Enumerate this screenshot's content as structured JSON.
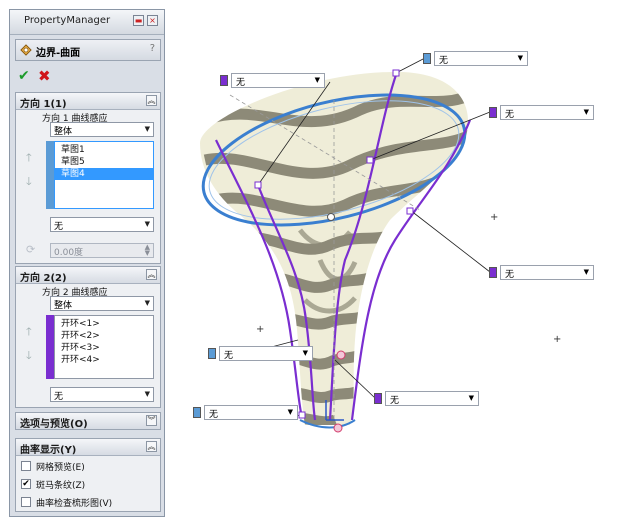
{
  "property_manager": {
    "title": "PropertyManager",
    "feature_title": "边界-曲面",
    "help": "?",
    "ok": "✔",
    "cancel": "✖"
  },
  "direction1": {
    "header": "方向 1(1)",
    "label": "方向 1 曲线感应",
    "influence": "整体",
    "items": [
      "草图1",
      "草图5",
      "草图4"
    ],
    "selected_index": 2,
    "tangency": "无",
    "angle_placeholder": "0.00度"
  },
  "direction2": {
    "header": "方向 2(2)",
    "label": "方向 2 曲线感应",
    "influence": "整体",
    "items": [
      "开环<1>",
      "开环<2>",
      "开环<3>",
      "开环<4>"
    ],
    "tangency": "无"
  },
  "options": {
    "header": "选项与预览(O)"
  },
  "curvature": {
    "header": "曲率显示(Y)",
    "items": [
      {
        "label": "网格预览(E)",
        "checked": false
      },
      {
        "label": "斑马条纹(Z)",
        "checked": true
      },
      {
        "label": "曲率检查梳形图(V)",
        "checked": false
      }
    ]
  },
  "overlays": [
    {
      "value": "无",
      "color": "#5b9bd5"
    },
    {
      "value": "无",
      "color": "#7a2ed0"
    },
    {
      "value": "无",
      "color": "#7a2ed0"
    },
    {
      "value": "无",
      "color": "#7a2ed0"
    },
    {
      "value": "无",
      "color": "#5b9bd5"
    },
    {
      "value": "无",
      "color": "#7a2ed0"
    },
    {
      "value": "无",
      "color": "#5b9bd5"
    }
  ],
  "colors": {
    "accent": "#3399ff",
    "edge_purple": "#7a2ed0",
    "edge_blue": "#3a7fd0"
  }
}
